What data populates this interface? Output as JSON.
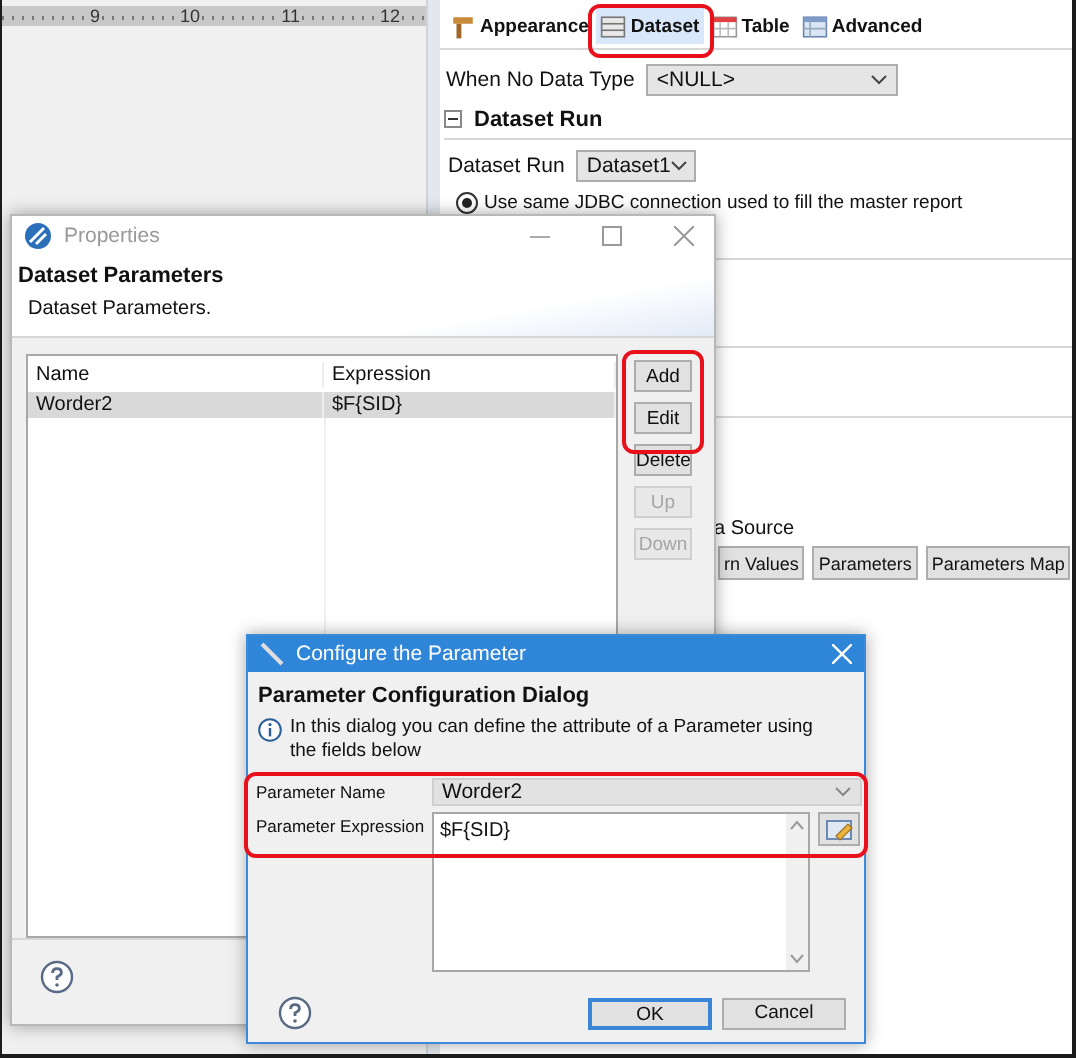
{
  "ruler": {
    "labels": [
      "9",
      "10",
      "11",
      "12"
    ]
  },
  "editor_panel": {
    "tabs": [
      {
        "label": "Appearance",
        "selected": false
      },
      {
        "label": "Dataset",
        "selected": true
      },
      {
        "label": "Table",
        "selected": false
      },
      {
        "label": "Advanced",
        "selected": false
      }
    ],
    "when_no_data_type": {
      "label": "When No Data Type",
      "value": "<NULL>"
    },
    "section": {
      "title": "Dataset Run",
      "expanded": true
    },
    "dataset_run": {
      "label": "Dataset Run",
      "value": "Dataset1"
    },
    "connection_option": {
      "label": "Use same JDBC connection used to fill the master report",
      "checked": true
    },
    "data_source_label": "a Source",
    "buttons": [
      "rn Values",
      "Parameters",
      "Parameters Map"
    ]
  },
  "properties_window": {
    "title": "Properties",
    "heading": "Dataset Parameters",
    "subheading": "Dataset Parameters.",
    "table": {
      "columns": [
        "Name",
        "Expression"
      ],
      "rows": [
        {
          "cells": [
            "Worder2",
            "$F{SID}"
          ],
          "selected": true
        }
      ]
    },
    "buttons": [
      {
        "label": "Add",
        "disabled": false
      },
      {
        "label": "Edit",
        "disabled": false
      },
      {
        "label": "Delete",
        "disabled": false
      },
      {
        "label": "Up",
        "disabled": true
      },
      {
        "label": "Down",
        "disabled": true
      }
    ]
  },
  "parameter_dialog": {
    "title": "Configure the Parameter",
    "heading": "Parameter Configuration Dialog",
    "info": "In this dialog you can define the attribute of a Parameter using the fields below",
    "fields": [
      {
        "kind": "select",
        "label": "Parameter Name",
        "value": "Worder2",
        "disabled": true
      },
      {
        "kind": "textarea",
        "label": "Parameter Expression",
        "value": "$F{SID}",
        "disabled": false
      }
    ],
    "buttons": [
      {
        "label": "OK",
        "default": true
      },
      {
        "label": "Cancel",
        "default": false
      }
    ]
  }
}
